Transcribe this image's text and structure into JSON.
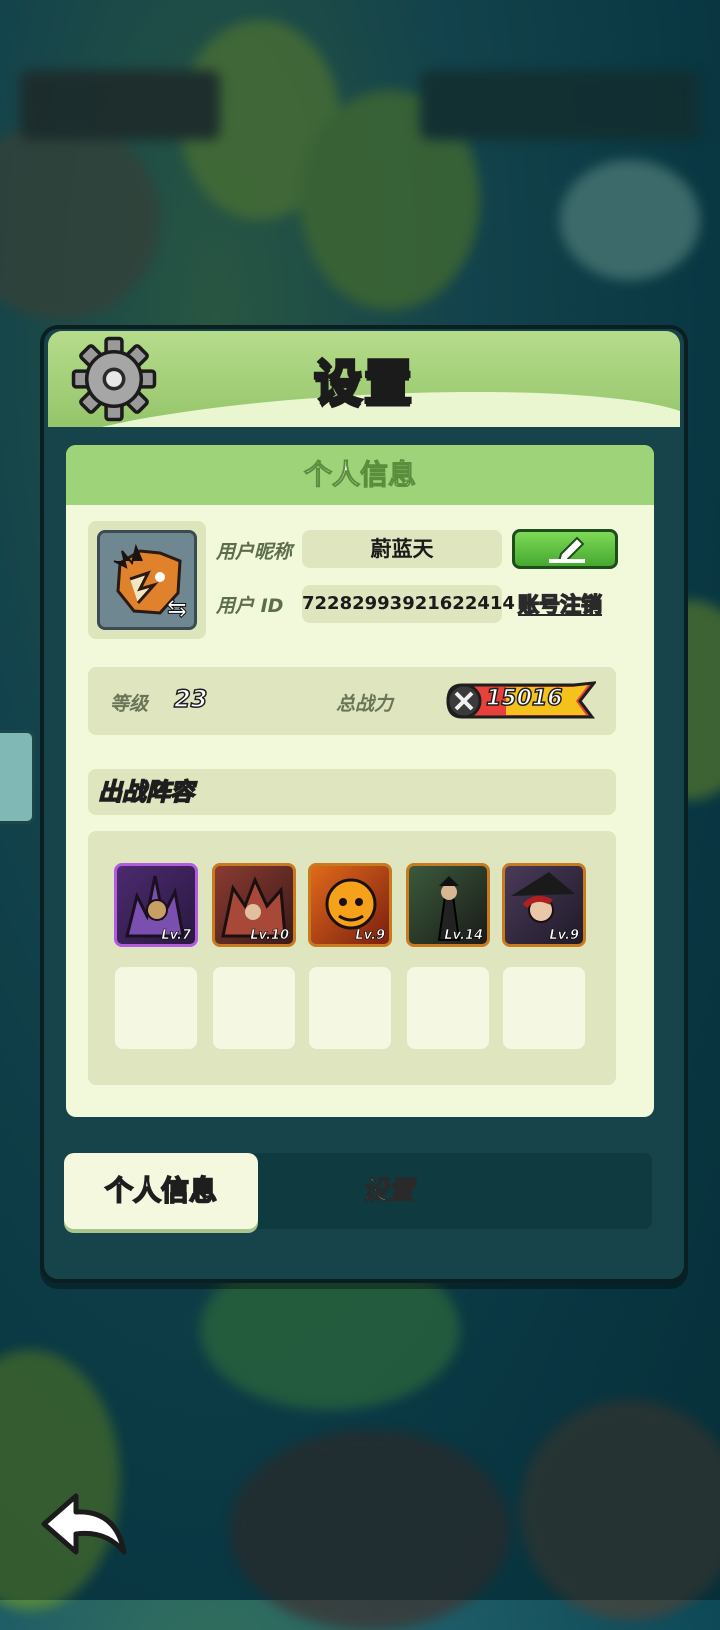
{
  "dialog": {
    "title": "设置",
    "panel_title": "个人信息"
  },
  "profile": {
    "nickname_label": "用户昵称",
    "nickname": "蔚蓝天",
    "id_label": "用户 ID",
    "user_id": "72282993921622414",
    "cancel_account": "账号注销"
  },
  "stats": {
    "level_label": "等级",
    "level": "23",
    "power_label": "总战力",
    "power": "15016"
  },
  "lineup": {
    "title": "出战阵容",
    "heroes": [
      {
        "level": "Lv.7",
        "frame": "purple"
      },
      {
        "level": "Lv.10",
        "frame": "orange"
      },
      {
        "level": "Lv.9",
        "frame": "orange"
      },
      {
        "level": "Lv.14",
        "frame": "orange"
      },
      {
        "level": "Lv.9",
        "frame": "orange"
      }
    ],
    "empty_slots": 5
  },
  "tabs": {
    "active": "个人信息",
    "other": "设置"
  },
  "icons": [
    "gear-icon",
    "swap-icon",
    "edit-icon",
    "sword-icon",
    "back-arrow-icon"
  ],
  "colors": {
    "header_green": "#9fd37a",
    "panel_bg": "#f2f8da",
    "edit_button": "#5dc043",
    "dialog_bg": "#16444a"
  }
}
